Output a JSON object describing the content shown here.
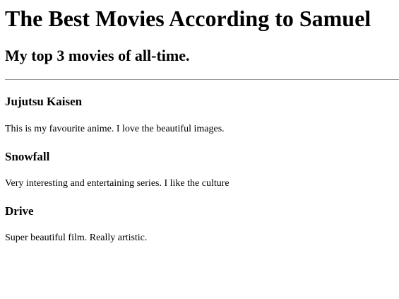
{
  "page": {
    "title": "The Best Movies According to Samuel",
    "subtitle": "My top 3 movies of all-time."
  },
  "movies": [
    {
      "title": "Jujutsu Kaisen",
      "description": "This is my favourite anime. I love the beautiful images."
    },
    {
      "title": "Snowfall",
      "description": "Very interesting and entertaining series. I like the culture"
    },
    {
      "title": "Drive",
      "description": "Super beautiful film. Really artistic."
    }
  ]
}
